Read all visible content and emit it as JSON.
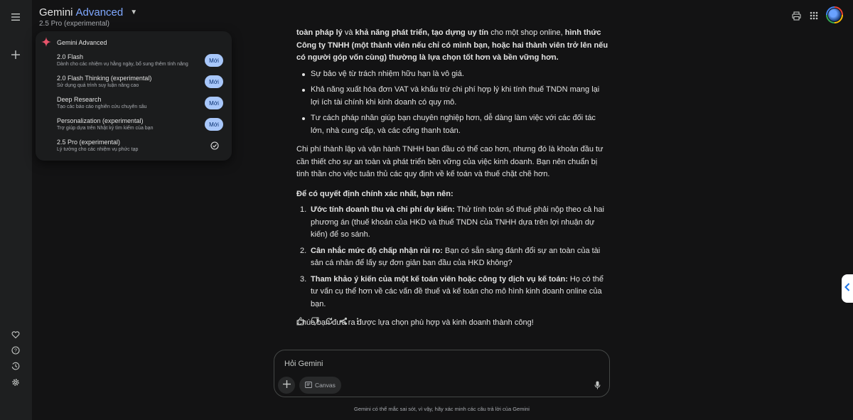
{
  "header": {
    "brand_name": "Gemini",
    "brand_tier": "Advanced",
    "model_label": "2.5 Pro (experimental)"
  },
  "menu": {
    "title": "Gemini Advanced",
    "items": [
      {
        "title": "2.0 Flash",
        "desc": "Dành cho các nhiệm vụ hằng ngày, bổ sung thêm tính năng",
        "badge": "Mới"
      },
      {
        "title": "2.0 Flash Thinking (experimental)",
        "desc": "Sử dụng quá trình suy luận nâng cao",
        "badge": "Mới"
      },
      {
        "title": "Deep Research",
        "desc": "Tạo các báo cáo nghiên cứu chuyên sâu",
        "badge": "Mới"
      },
      {
        "title": "Personalization (experimental)",
        "desc": "Trợ giúp dựa trên Nhật ký tìm kiếm của bạn",
        "badge": "Mới"
      },
      {
        "title": "2.5 Pro (experimental)",
        "desc": "Lý tưởng cho các nhiệm vụ phức tạp",
        "badge": ""
      }
    ]
  },
  "response": {
    "p1_b1": "toàn pháp lý",
    "p1_t1": " và ",
    "p1_b2": "khả năng phát triển, tạo dựng uy tín",
    "p1_t2": " cho một shop online, ",
    "p1_b3": "hình thức Công ty TNHH (một thành viên nếu chỉ có mình bạn, hoặc hai thành viên trở lên nếu có người góp vốn cùng) thường là lựa chọn tốt hơn và bền vững hơn.",
    "bullets": [
      "Sự bảo vệ từ trách nhiệm hữu hạn là vô giá.",
      "Khả năng xuất hóa đơn VAT và khấu trừ chi phí hợp lý khi tính thuế TNDN mang lại lợi ích tài chính khi kinh doanh có quy mô.",
      "Tư cách pháp nhân giúp bạn chuyên nghiệp hơn, dễ dàng làm việc với các đối tác lớn, nhà cung cấp, và các cổng thanh toán."
    ],
    "p2": "Chi phí thành lập và vận hành TNHH ban đầu có thể cao hơn, nhưng đó là khoản đầu tư cần thiết cho sự an toàn và phát triển bền vững của việc kinh doanh. Bạn nên chuẩn bị tinh thần cho việc tuân thủ các quy định về kế toán và thuế chặt chẽ hơn.",
    "p3": "Để có quyết định chính xác nhất, bạn nên:",
    "steps": [
      {
        "num": "1.",
        "bold": "Ước tính doanh thu và chi phí dự kiến:",
        "text": " Thử tính toán số thuế phải nộp theo cả hai phương án (thuế khoán của HKD và thuế TNDN của TNHH dựa trên lợi nhuận dự kiến) để so sánh."
      },
      {
        "num": "2.",
        "bold": "Cân nhắc mức độ chấp nhận rủi ro:",
        "text": " Bạn có sẵn sàng đánh đổi sự an toàn của tài sản cá nhân để lấy sự đơn giản ban đầu của HKD không?"
      },
      {
        "num": "3.",
        "bold": "Tham khảo ý kiến của một kế toán viên hoặc công ty dịch vụ kế toán:",
        "text": " Họ có thể tư vấn cụ thể hơn về các vấn đề thuế và kế toán cho mô hình kinh doanh online của bạn."
      }
    ],
    "closing": "Chúc bạn đưa ra được lựa chọn phù hợp và kinh doanh thành công!"
  },
  "input": {
    "placeholder": "Hỏi Gemini",
    "canvas_label": "Canvas"
  },
  "disclaimer": "Gemini có thể mắc sai sót, vì vậy, hãy xác minh các câu trả lời của Gemini",
  "colors": {
    "background": "#131314",
    "rail": "#1e1f20",
    "menu": "#1b1c1d",
    "accent_text": "#7fa8ff",
    "badge_bg": "#a8c7fa",
    "badge_text": "#062e6f"
  },
  "icons": [
    "menu-icon",
    "new-chat-icon",
    "gem-icon",
    "help-icon",
    "activity-icon",
    "settings-icon",
    "chevron-down-icon",
    "sparkle-icon",
    "check-circle-icon",
    "print-icon",
    "apps-grid-icon",
    "thumb-up-icon",
    "thumb-down-icon",
    "regenerate-icon",
    "share-icon",
    "more-vert-icon",
    "plus-icon",
    "canvas-icon",
    "mic-icon",
    "chevron-left-icon"
  ]
}
